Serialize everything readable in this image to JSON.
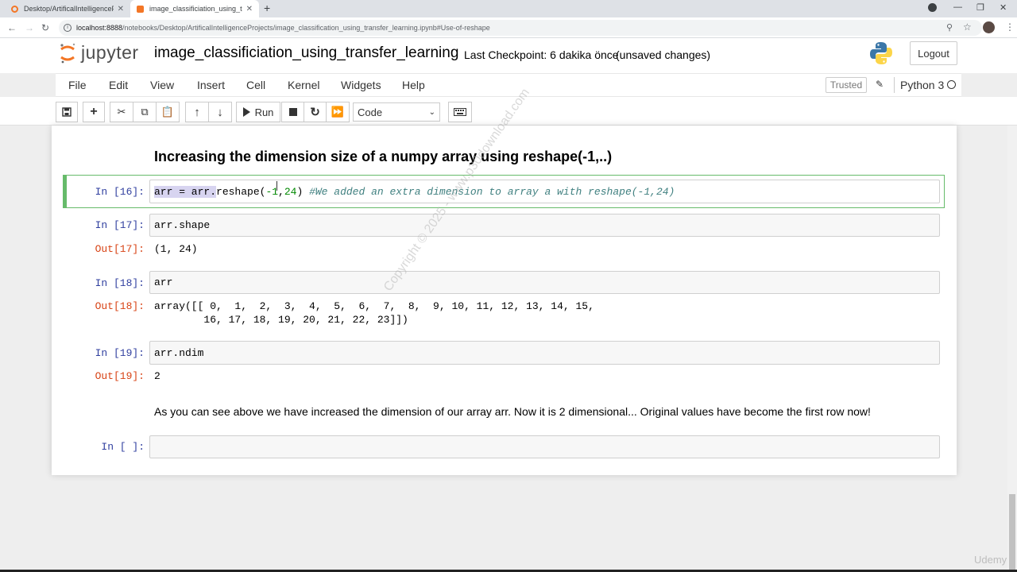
{
  "browser": {
    "tabs": [
      {
        "title": "Desktop/ArtificalIntelligenceProj",
        "active": false
      },
      {
        "title": "image_classificiation_using_transf",
        "active": true
      }
    ],
    "url_host": "localhost:8888",
    "url_path": "/notebooks/Desktop/ArtificalIntelligenceProjects/image_classification_using_transfer_learning.ipynb#Use-of-reshape"
  },
  "header": {
    "logo_text": "jupyter",
    "notebook_name": "image_classificiation_using_transfer_learning",
    "checkpoint": "Last Checkpoint: 6 dakika önce",
    "unsaved": "(unsaved changes)",
    "logout_label": "Logout"
  },
  "menu": {
    "items": [
      "File",
      "Edit",
      "View",
      "Insert",
      "Cell",
      "Kernel",
      "Widgets",
      "Help"
    ],
    "trusted": "Trusted",
    "kernel_name": "Python 3"
  },
  "toolbar": {
    "run_label": "Run",
    "cell_type": "Code"
  },
  "cells": {
    "heading": "Increasing the dimension size of a numpy array using reshape(-1,..)",
    "c16": {
      "prompt": "In [16]:",
      "code_hl": "arr = arr.",
      "code_call": "reshape(",
      "code_num1": "-1",
      "code_sep": ",",
      "code_num2": "24",
      "code_close": ") ",
      "code_comment": "#We added an extra dimension to array a with reshape(-1,24)"
    },
    "c17": {
      "prompt": "In [17]:",
      "code": "arr.shape",
      "out_prompt": "Out[17]:",
      "output": "(1, 24)"
    },
    "c18": {
      "prompt": "In [18]:",
      "code": "arr",
      "out_prompt": "Out[18]:",
      "output_line1": "array([[ 0,  1,  2,  3,  4,  5,  6,  7,  8,  9, 10, 11, 12, 13, 14, 15,",
      "output_line2": "        16, 17, 18, 19, 20, 21, 22, 23]])"
    },
    "c19": {
      "prompt": "In [19]:",
      "code": "arr.ndim",
      "out_prompt": "Out[19]:",
      "output": "2"
    },
    "markdown_text": "As you can see above we have increased the dimension of our array arr. Now it is 2 dimensional... Original values have become the first row now!",
    "empty_prompt": "In [ ]:"
  },
  "overlay": {
    "watermark": "Copyright © 2025 - www.p30download.com",
    "udemy": "Udemy"
  }
}
